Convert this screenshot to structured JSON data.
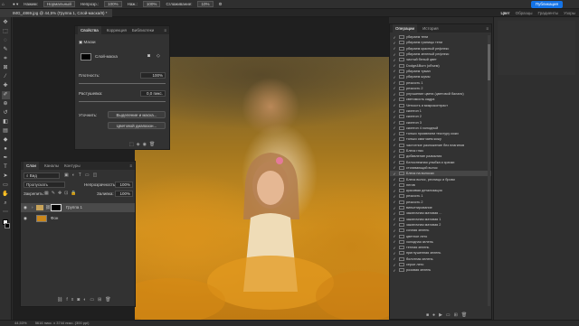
{
  "options_bar": {
    "size_label": "Нажим:",
    "mode_label": "Нормальный",
    "opacity_label": "Непрозр.:",
    "opacity_value": "100%",
    "flow_label": "Наж.:",
    "flow_value": "100%",
    "smoothing_label": "Сглаживание:",
    "smoothing_value": "10%",
    "publish": "Публикация"
  },
  "document": {
    "tab_title": "IMG_4869.jpg @ 44,5% (Группа 1, Слой-маска/8) *",
    "zoom": "44,53%",
    "status": "5616 пикс. x 3744 пикс. (300 ppi)"
  },
  "workspace_tabs": [
    "Цвет",
    "Образцы",
    "Градиенты",
    "Узоры"
  ],
  "toolbar": {
    "tools": [
      "move-tool",
      "marquee-tool",
      "lasso-tool",
      "quick-select-tool",
      "crop-tool",
      "frame-tool",
      "eyedropper-tool",
      "healing-tool",
      "brush-tool",
      "clone-tool",
      "history-brush-tool",
      "eraser-tool",
      "gradient-tool",
      "blur-tool",
      "dodge-tool",
      "pen-tool",
      "type-tool",
      "path-select-tool",
      "shape-tool",
      "hand-tool",
      "zoom-tool",
      "more-tools"
    ]
  },
  "properties": {
    "tabs": [
      "Свойства",
      "Коррекция",
      "Библиотеки"
    ],
    "section": "Маски",
    "layer_mask_label": "Слой-маска",
    "density_label": "Плотность:",
    "density_value": "100%",
    "feather_label": "Растушевка:",
    "feather_value": "0,0 пикс.",
    "refine_label": "Уточнить:",
    "select_and_mask": "Выделение и маска...",
    "color_range": "Цветовой диапазон..."
  },
  "layers": {
    "tabs": [
      "Слои",
      "Каналы",
      "Контуры"
    ],
    "filter_placeholder": "Вид",
    "blend_mode": "Пропускать",
    "opacity_label": "Непрозрачность:",
    "opacity_value": "100%",
    "lock_label": "Закрепить:",
    "fill_label": "Заливка:",
    "fill_value": "100%",
    "items": [
      {
        "name": "Группа 1",
        "type": "group"
      },
      {
        "name": "Фон",
        "type": "background"
      }
    ]
  },
  "history": {
    "tabs": [
      "Операции",
      "История"
    ],
    "items": [
      "убираем тени",
      "убираем границы тени",
      "убираем красный рефлекс",
      "убираем зеленый рефлекс",
      "чистый белый цвет",
      "Dodge&Burn (объем)",
      "убираем туман",
      "убираем шумы",
      "резкость 1",
      "резкость 2",
      "улучшение цвета (цветовой баланс)",
      "светимость кадра",
      "Четкость и микроконтраст",
      "скинтон 1",
      "скинтон 2",
      "скинтон 3",
      "скинтон 4 холодный",
      "только проявляем текстуру кожи",
      "только смягчаем кожу",
      "частотное разложение без плагинов",
      "Блеск глаз",
      "добавление размытия",
      "Белоснежная улыбка и зрачки",
      "стягивающий волос",
      "Блеск на волосах",
      "Блеск волос, ресницы и брови",
      "негив",
      "красивая детализация",
      "резкость 1",
      "резкость 2",
      "виньетирование",
      "закаточная матовая ...",
      "закаточная матовая 1",
      "закаточная матовая 2",
      "сочная зелень",
      "цветное лето",
      "холодная зелень",
      "теплая зелень",
      "приглушенная зелень",
      "болотная зелень",
      "серое лето",
      "розовая зелень"
    ],
    "selected_index": 24
  },
  "colors": {
    "accent": "#1473e6",
    "panel": "#323232",
    "bg": "#2b2b2b"
  }
}
